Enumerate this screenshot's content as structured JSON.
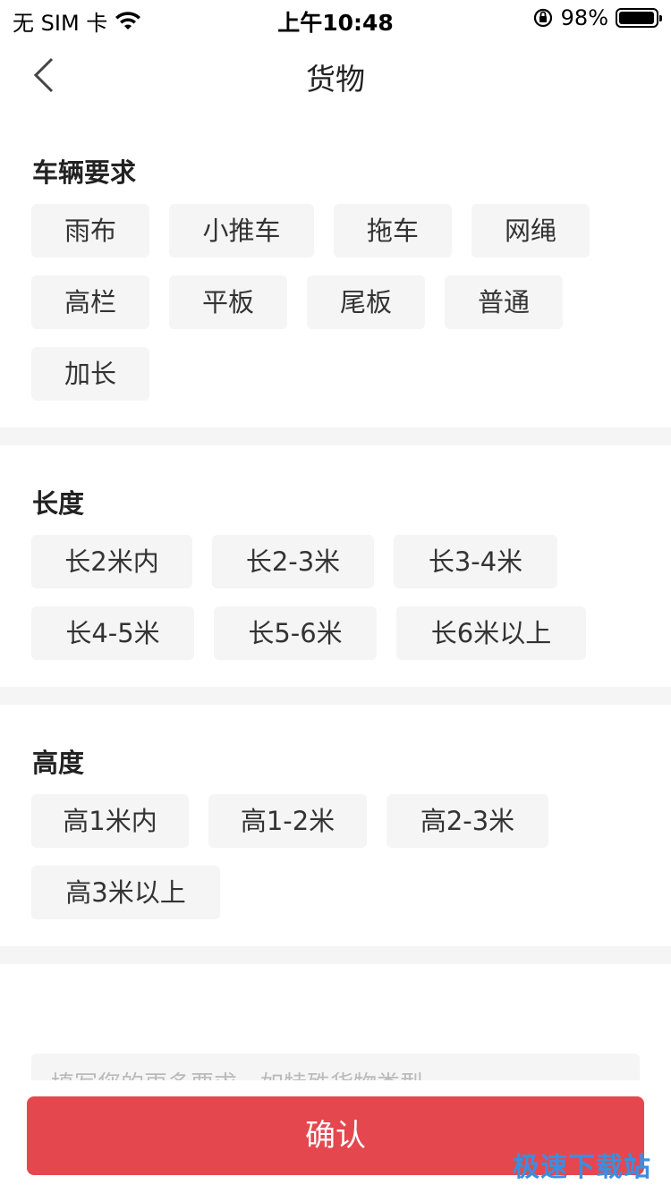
{
  "status": {
    "carrier": "无 SIM 卡",
    "time": "上午10:48",
    "battery": "98%",
    "battery_level": 0.98
  },
  "nav": {
    "title": "货物"
  },
  "vehicle": {
    "title": "车辆要求",
    "tags": [
      "雨布",
      "小推车",
      "拖车",
      "网绳",
      "高栏",
      "平板",
      "尾板",
      "普通",
      "加长"
    ]
  },
  "length": {
    "title": "长度",
    "tags": [
      "长2米内",
      "长2-3米",
      "长3-4米",
      "长4-5米",
      "长5-6米",
      "长6米以上"
    ]
  },
  "height": {
    "title": "高度",
    "tags": [
      "高1米内",
      "高1-2米",
      "高2-3米",
      "高3米以上"
    ]
  },
  "remark": {
    "placeholder": "填写您的更多要求，如特殊货物类型"
  },
  "confirm": {
    "label": "确认"
  },
  "watermark": {
    "text": "极速下载站"
  },
  "colors": {
    "accent": "#e5474f",
    "tag_bg": "#f5f5f5",
    "divider": "#f5f5f5"
  }
}
